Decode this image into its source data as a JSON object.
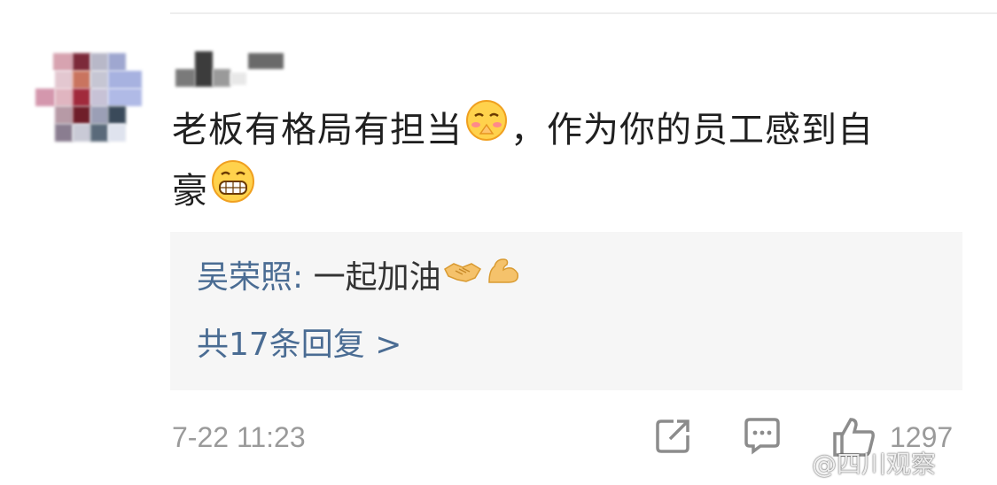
{
  "comment": {
    "text_line1": "老板有格局有担当",
    "emoji_1": "smirk-blush-emoji",
    "text_line1_cont": "，作为你的员工感到自",
    "text_line2": "豪",
    "emoji_2": "grin-emoji"
  },
  "reply": {
    "author": "吴荣照",
    "separator": ": ",
    "text": "一起加油",
    "emoji_1": "handshake-emoji",
    "emoji_2": "flexed-biceps-emoji",
    "count_label": "共17条回复 >"
  },
  "footer": {
    "timestamp": "7-22 11:23",
    "like_count": "1297",
    "share_icon": "share-icon",
    "comment_icon": "comment-icon",
    "like_icon": "thumbs-up-icon"
  },
  "watermark": {
    "text": "@四川观察"
  },
  "colors": {
    "link_blue": "#4a6c93",
    "meta_gray": "#9a9a9a",
    "reply_bg": "#f6f6f6"
  }
}
